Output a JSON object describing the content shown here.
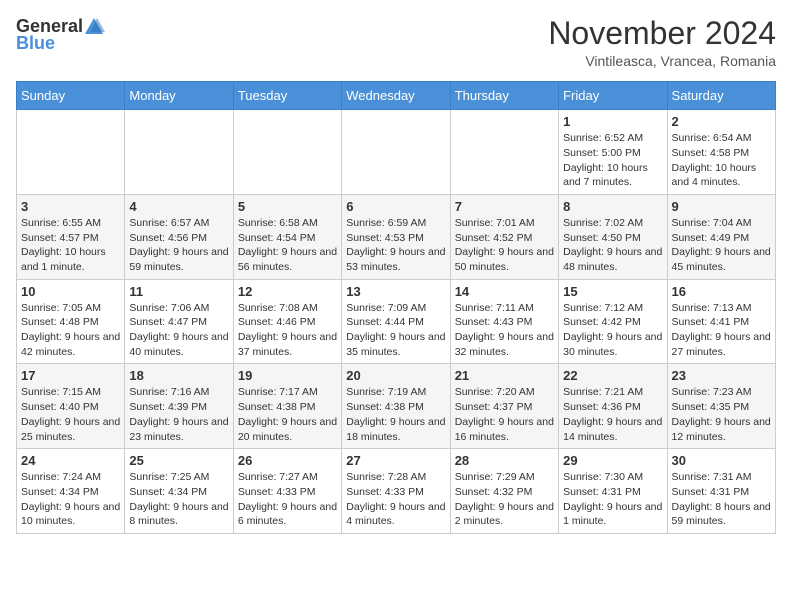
{
  "header": {
    "logo": {
      "text_general": "General",
      "text_blue": "Blue"
    },
    "title": "November 2024",
    "subtitle": "Vintileasca, Vrancea, Romania"
  },
  "weekdays": [
    "Sunday",
    "Monday",
    "Tuesday",
    "Wednesday",
    "Thursday",
    "Friday",
    "Saturday"
  ],
  "weeks": [
    [
      {
        "day": "",
        "info": ""
      },
      {
        "day": "",
        "info": ""
      },
      {
        "day": "",
        "info": ""
      },
      {
        "day": "",
        "info": ""
      },
      {
        "day": "",
        "info": ""
      },
      {
        "day": "1",
        "info": "Sunrise: 6:52 AM\nSunset: 5:00 PM\nDaylight: 10 hours and 7 minutes."
      },
      {
        "day": "2",
        "info": "Sunrise: 6:54 AM\nSunset: 4:58 PM\nDaylight: 10 hours and 4 minutes."
      }
    ],
    [
      {
        "day": "3",
        "info": "Sunrise: 6:55 AM\nSunset: 4:57 PM\nDaylight: 10 hours and 1 minute."
      },
      {
        "day": "4",
        "info": "Sunrise: 6:57 AM\nSunset: 4:56 PM\nDaylight: 9 hours and 59 minutes."
      },
      {
        "day": "5",
        "info": "Sunrise: 6:58 AM\nSunset: 4:54 PM\nDaylight: 9 hours and 56 minutes."
      },
      {
        "day": "6",
        "info": "Sunrise: 6:59 AM\nSunset: 4:53 PM\nDaylight: 9 hours and 53 minutes."
      },
      {
        "day": "7",
        "info": "Sunrise: 7:01 AM\nSunset: 4:52 PM\nDaylight: 9 hours and 50 minutes."
      },
      {
        "day": "8",
        "info": "Sunrise: 7:02 AM\nSunset: 4:50 PM\nDaylight: 9 hours and 48 minutes."
      },
      {
        "day": "9",
        "info": "Sunrise: 7:04 AM\nSunset: 4:49 PM\nDaylight: 9 hours and 45 minutes."
      }
    ],
    [
      {
        "day": "10",
        "info": "Sunrise: 7:05 AM\nSunset: 4:48 PM\nDaylight: 9 hours and 42 minutes."
      },
      {
        "day": "11",
        "info": "Sunrise: 7:06 AM\nSunset: 4:47 PM\nDaylight: 9 hours and 40 minutes."
      },
      {
        "day": "12",
        "info": "Sunrise: 7:08 AM\nSunset: 4:46 PM\nDaylight: 9 hours and 37 minutes."
      },
      {
        "day": "13",
        "info": "Sunrise: 7:09 AM\nSunset: 4:44 PM\nDaylight: 9 hours and 35 minutes."
      },
      {
        "day": "14",
        "info": "Sunrise: 7:11 AM\nSunset: 4:43 PM\nDaylight: 9 hours and 32 minutes."
      },
      {
        "day": "15",
        "info": "Sunrise: 7:12 AM\nSunset: 4:42 PM\nDaylight: 9 hours and 30 minutes."
      },
      {
        "day": "16",
        "info": "Sunrise: 7:13 AM\nSunset: 4:41 PM\nDaylight: 9 hours and 27 minutes."
      }
    ],
    [
      {
        "day": "17",
        "info": "Sunrise: 7:15 AM\nSunset: 4:40 PM\nDaylight: 9 hours and 25 minutes."
      },
      {
        "day": "18",
        "info": "Sunrise: 7:16 AM\nSunset: 4:39 PM\nDaylight: 9 hours and 23 minutes."
      },
      {
        "day": "19",
        "info": "Sunrise: 7:17 AM\nSunset: 4:38 PM\nDaylight: 9 hours and 20 minutes."
      },
      {
        "day": "20",
        "info": "Sunrise: 7:19 AM\nSunset: 4:38 PM\nDaylight: 9 hours and 18 minutes."
      },
      {
        "day": "21",
        "info": "Sunrise: 7:20 AM\nSunset: 4:37 PM\nDaylight: 9 hours and 16 minutes."
      },
      {
        "day": "22",
        "info": "Sunrise: 7:21 AM\nSunset: 4:36 PM\nDaylight: 9 hours and 14 minutes."
      },
      {
        "day": "23",
        "info": "Sunrise: 7:23 AM\nSunset: 4:35 PM\nDaylight: 9 hours and 12 minutes."
      }
    ],
    [
      {
        "day": "24",
        "info": "Sunrise: 7:24 AM\nSunset: 4:34 PM\nDaylight: 9 hours and 10 minutes."
      },
      {
        "day": "25",
        "info": "Sunrise: 7:25 AM\nSunset: 4:34 PM\nDaylight: 9 hours and 8 minutes."
      },
      {
        "day": "26",
        "info": "Sunrise: 7:27 AM\nSunset: 4:33 PM\nDaylight: 9 hours and 6 minutes."
      },
      {
        "day": "27",
        "info": "Sunrise: 7:28 AM\nSunset: 4:33 PM\nDaylight: 9 hours and 4 minutes."
      },
      {
        "day": "28",
        "info": "Sunrise: 7:29 AM\nSunset: 4:32 PM\nDaylight: 9 hours and 2 minutes."
      },
      {
        "day": "29",
        "info": "Sunrise: 7:30 AM\nSunset: 4:31 PM\nDaylight: 9 hours and 1 minute."
      },
      {
        "day": "30",
        "info": "Sunrise: 7:31 AM\nSunset: 4:31 PM\nDaylight: 8 hours and 59 minutes."
      }
    ]
  ]
}
